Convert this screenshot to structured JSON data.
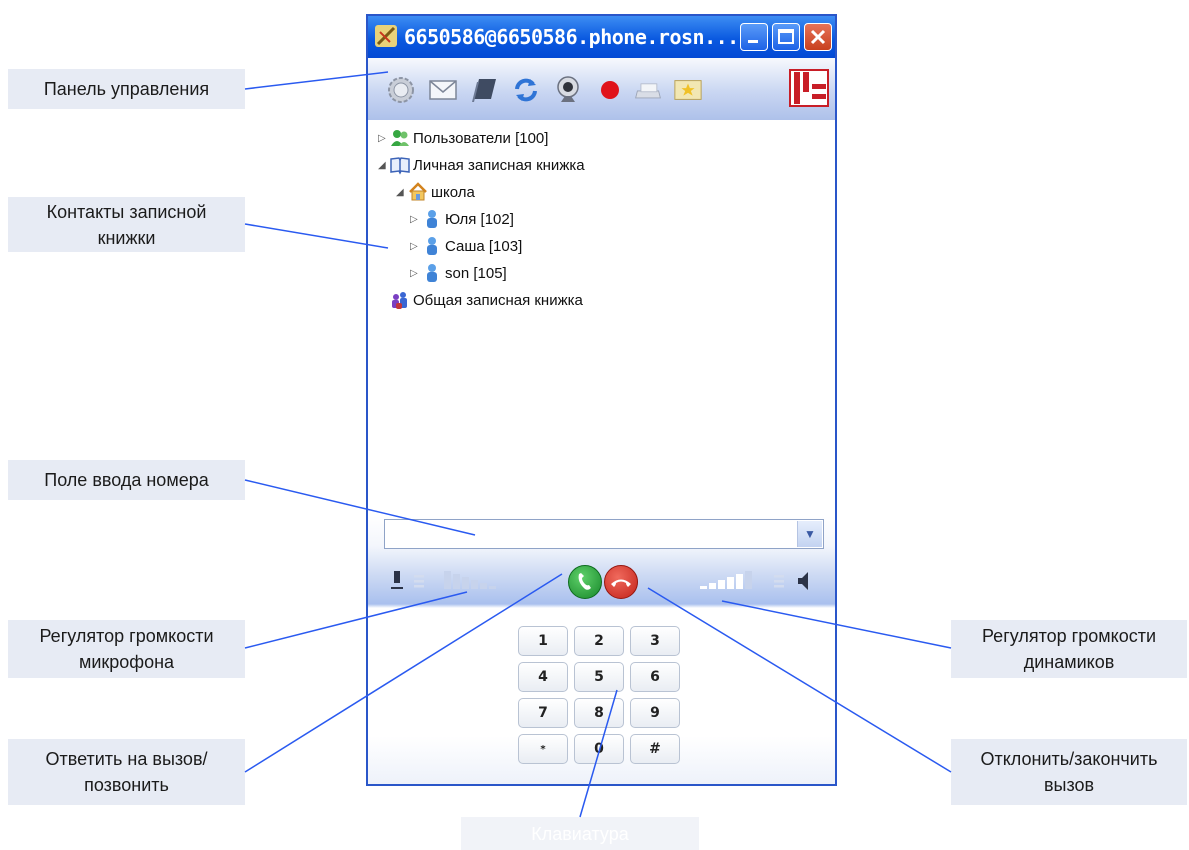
{
  "window": {
    "title": "6650586@6650586.phone.rosn...",
    "buttons": {
      "minimize": "minimize-icon",
      "maximize": "maximize-icon",
      "close": "close-icon"
    }
  },
  "toolbar": {
    "icons": [
      "settings-gear-icon",
      "mail-icon",
      "address-book-icon",
      "refresh-icon",
      "webcam-icon",
      "record-icon",
      "fax-icon",
      "vcard-icon",
      "logo-icon"
    ]
  },
  "tree": {
    "users": "Пользователи [100]",
    "personal_book": "Личная записная книжка",
    "group_school": "школа",
    "contact1": "Юля [102]",
    "contact2": "Саша [103]",
    "contact3": "son [105]",
    "shared_book": "Общая записная книжка"
  },
  "number_field": {
    "value": ""
  },
  "keypad": [
    "1",
    "2",
    "3",
    "4",
    "5",
    "6",
    "7",
    "8",
    "9",
    "*",
    "0",
    "#"
  ],
  "callouts": {
    "control_panel": "Панель управления",
    "notebook_contacts": [
      "Контакты записной",
      "книжки"
    ],
    "number_field": "Поле ввода номера",
    "mic_volume": [
      "Регулятор громкости",
      "микрофона"
    ],
    "answer_call": [
      "Ответить на вызов/",
      "позвонить"
    ],
    "speaker_volume": [
      "Регулятор громкости",
      "динамиков"
    ],
    "reject_call": [
      "Отклонить/закончить",
      "вызов"
    ],
    "keyboard": "Клавиатура"
  },
  "colors": {
    "accent": "#0a59e0",
    "line": "#2a5af0",
    "answer": "#1c9a2c",
    "reject": "#d62d20"
  }
}
